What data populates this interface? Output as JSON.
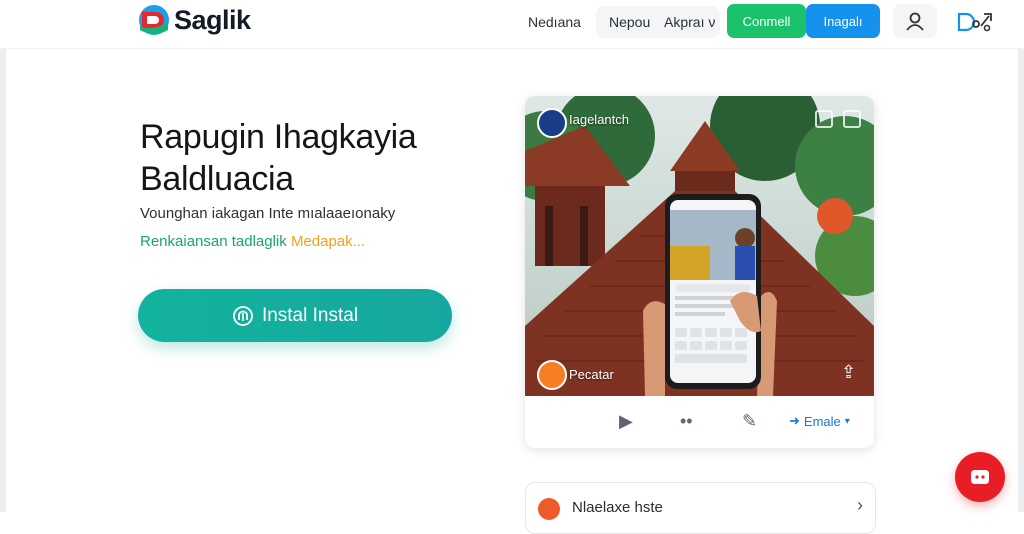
{
  "header": {
    "logo_text": "Saglik",
    "nav": [
      "Nedıana",
      "Nepou",
      "Akpraı ν"
    ],
    "cta_green": "Conmell",
    "cta_blue": "Inagalı"
  },
  "hero": {
    "title_line1": "Rapugin Ihagkayia",
    "title_line2": "Baldluacia",
    "subtitle": "Vounghan iakagan Inte mıalaaeıonaky",
    "tag_green": "Renkaiansan tadlaglik",
    "tag_orange": "Medapak...",
    "install_label": "Instal Instal"
  },
  "card": {
    "top_user": "Iagelantch",
    "author": "Pecatar",
    "action_link": "Emale"
  },
  "bottom_card": {
    "title": "Nlaelaxe hste"
  },
  "colors": {
    "primary_teal": "#13b39d",
    "green": "#19c26b",
    "blue": "#1591ee",
    "fab_red": "#e81d25"
  },
  "icons": [
    "logo-icon",
    "user-icon",
    "install-icon",
    "share-icon",
    "play-icon",
    "dots-icon",
    "edit-icon",
    "link-icon",
    "chevron-right-icon",
    "chat-icon"
  ]
}
